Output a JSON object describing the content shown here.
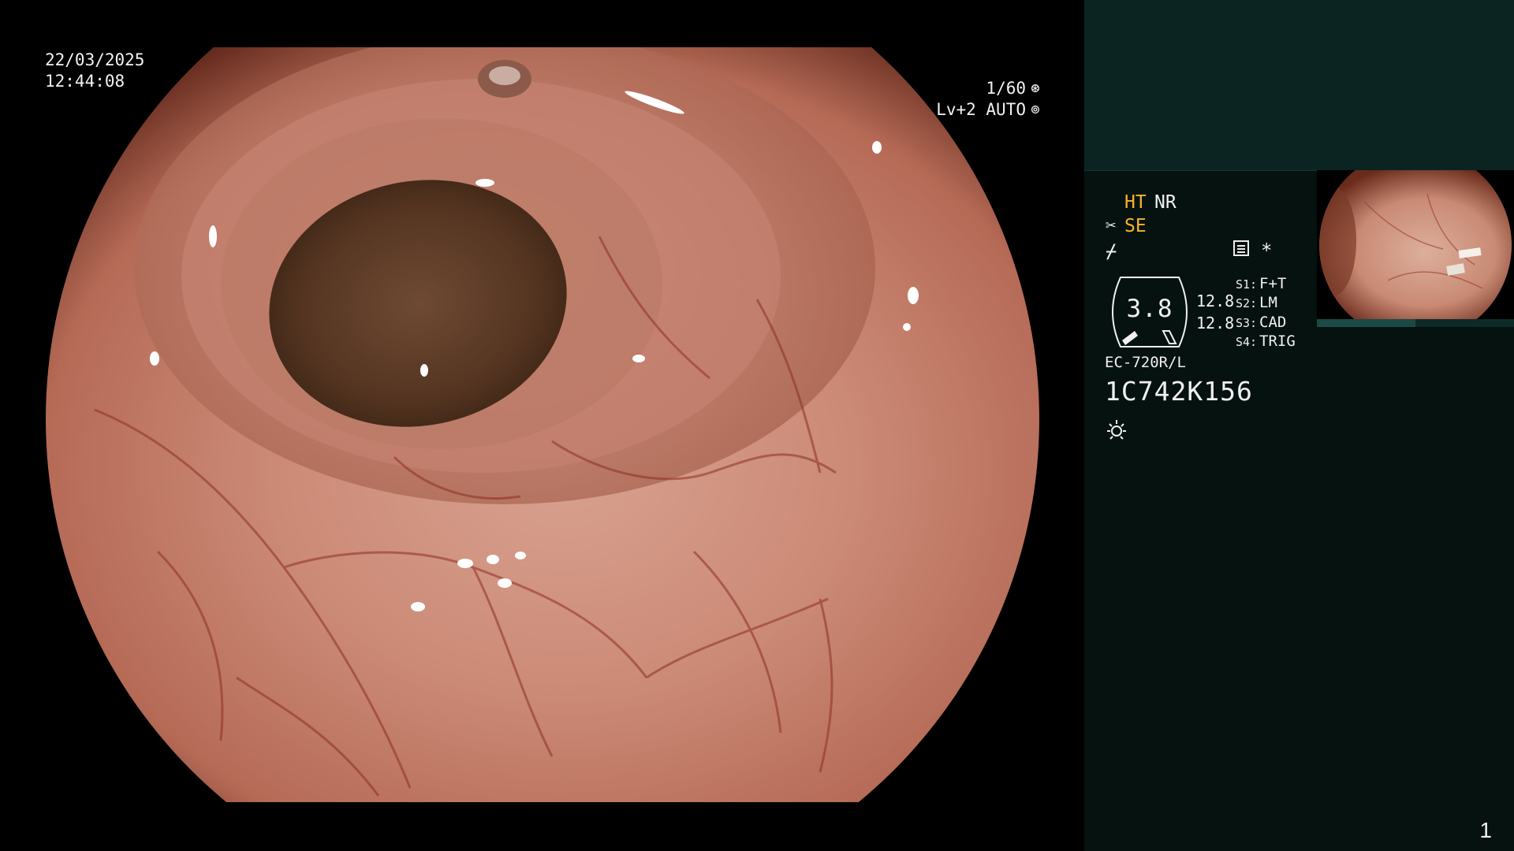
{
  "overlay": {
    "date": "22/03/2025",
    "time": "12:44:08",
    "shutter": "1/60",
    "shutter_icon": "aperture-icon",
    "exposure_mode": "Lv+2 AUTO",
    "exposure_icon": "auto-exposure-icon"
  },
  "panel": {
    "image_modes": {
      "ht": "HT",
      "nr": "NR",
      "se": "SE"
    },
    "icons": [
      "scissors-icon",
      "filter-icon",
      "memo-icon",
      "star-icon",
      "light-icon"
    ],
    "star": "*",
    "zoom": {
      "value": "3.8",
      "label_top": "12.8",
      "label_bottom": "12.8"
    },
    "scope_buttons": [
      {
        "key": "S1:",
        "value": "F+T"
      },
      {
        "key": "S2:",
        "value": "LM"
      },
      {
        "key": "S3:",
        "value": "CAD"
      },
      {
        "key": "S4:",
        "value": "TRIG"
      }
    ],
    "scope_model": "EC-720R/L",
    "scope_serial": "1C742K156",
    "page_number": "1"
  },
  "colors": {
    "panel_bg": "#061210",
    "panel_header_bg": "#0b2422",
    "accent_yellow": "#f7b42c",
    "text_white": "#f0f0f0"
  }
}
